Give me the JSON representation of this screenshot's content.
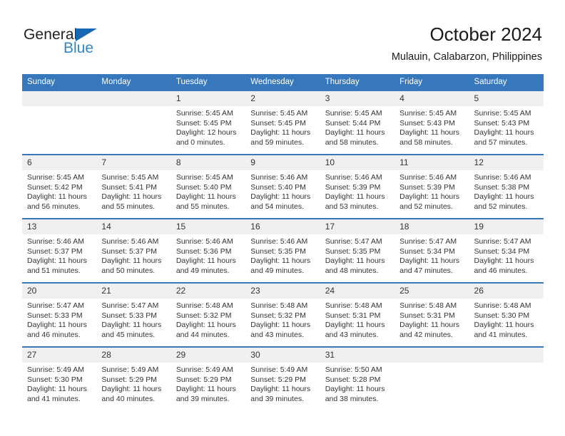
{
  "brand": {
    "name_part1": "General",
    "name_part2": "Blue",
    "accent_color": "#1668b3",
    "blue_text_color": "#2e86c8",
    "flag_icon": "flag-triangle-icon"
  },
  "header": {
    "title": "October 2024",
    "subtitle": "Mulauin, Calabarzon, Philippines"
  },
  "theme": {
    "header_blue": "#3777BC",
    "date_strip_gray": "#F0F0F0",
    "text_color": "#333333"
  },
  "calendar": {
    "weekday_headers": [
      "Sunday",
      "Monday",
      "Tuesday",
      "Wednesday",
      "Thursday",
      "Friday",
      "Saturday"
    ],
    "weeks": [
      [
        {
          "date": "",
          "sunrise": "",
          "sunset": "",
          "daylight": "",
          "empty": true
        },
        {
          "date": "",
          "sunrise": "",
          "sunset": "",
          "daylight": "",
          "empty": true
        },
        {
          "date": "1",
          "sunrise": "Sunrise: 5:45 AM",
          "sunset": "Sunset: 5:45 PM",
          "daylight": "Daylight: 12 hours and 0 minutes."
        },
        {
          "date": "2",
          "sunrise": "Sunrise: 5:45 AM",
          "sunset": "Sunset: 5:45 PM",
          "daylight": "Daylight: 11 hours and 59 minutes."
        },
        {
          "date": "3",
          "sunrise": "Sunrise: 5:45 AM",
          "sunset": "Sunset: 5:44 PM",
          "daylight": "Daylight: 11 hours and 58 minutes."
        },
        {
          "date": "4",
          "sunrise": "Sunrise: 5:45 AM",
          "sunset": "Sunset: 5:43 PM",
          "daylight": "Daylight: 11 hours and 58 minutes."
        },
        {
          "date": "5",
          "sunrise": "Sunrise: 5:45 AM",
          "sunset": "Sunset: 5:43 PM",
          "daylight": "Daylight: 11 hours and 57 minutes."
        }
      ],
      [
        {
          "date": "6",
          "sunrise": "Sunrise: 5:45 AM",
          "sunset": "Sunset: 5:42 PM",
          "daylight": "Daylight: 11 hours and 56 minutes."
        },
        {
          "date": "7",
          "sunrise": "Sunrise: 5:45 AM",
          "sunset": "Sunset: 5:41 PM",
          "daylight": "Daylight: 11 hours and 55 minutes."
        },
        {
          "date": "8",
          "sunrise": "Sunrise: 5:45 AM",
          "sunset": "Sunset: 5:40 PM",
          "daylight": "Daylight: 11 hours and 55 minutes."
        },
        {
          "date": "9",
          "sunrise": "Sunrise: 5:46 AM",
          "sunset": "Sunset: 5:40 PM",
          "daylight": "Daylight: 11 hours and 54 minutes."
        },
        {
          "date": "10",
          "sunrise": "Sunrise: 5:46 AM",
          "sunset": "Sunset: 5:39 PM",
          "daylight": "Daylight: 11 hours and 53 minutes."
        },
        {
          "date": "11",
          "sunrise": "Sunrise: 5:46 AM",
          "sunset": "Sunset: 5:39 PM",
          "daylight": "Daylight: 11 hours and 52 minutes."
        },
        {
          "date": "12",
          "sunrise": "Sunrise: 5:46 AM",
          "sunset": "Sunset: 5:38 PM",
          "daylight": "Daylight: 11 hours and 52 minutes."
        }
      ],
      [
        {
          "date": "13",
          "sunrise": "Sunrise: 5:46 AM",
          "sunset": "Sunset: 5:37 PM",
          "daylight": "Daylight: 11 hours and 51 minutes."
        },
        {
          "date": "14",
          "sunrise": "Sunrise: 5:46 AM",
          "sunset": "Sunset: 5:37 PM",
          "daylight": "Daylight: 11 hours and 50 minutes."
        },
        {
          "date": "15",
          "sunrise": "Sunrise: 5:46 AM",
          "sunset": "Sunset: 5:36 PM",
          "daylight": "Daylight: 11 hours and 49 minutes."
        },
        {
          "date": "16",
          "sunrise": "Sunrise: 5:46 AM",
          "sunset": "Sunset: 5:35 PM",
          "daylight": "Daylight: 11 hours and 49 minutes."
        },
        {
          "date": "17",
          "sunrise": "Sunrise: 5:47 AM",
          "sunset": "Sunset: 5:35 PM",
          "daylight": "Daylight: 11 hours and 48 minutes."
        },
        {
          "date": "18",
          "sunrise": "Sunrise: 5:47 AM",
          "sunset": "Sunset: 5:34 PM",
          "daylight": "Daylight: 11 hours and 47 minutes."
        },
        {
          "date": "19",
          "sunrise": "Sunrise: 5:47 AM",
          "sunset": "Sunset: 5:34 PM",
          "daylight": "Daylight: 11 hours and 46 minutes."
        }
      ],
      [
        {
          "date": "20",
          "sunrise": "Sunrise: 5:47 AM",
          "sunset": "Sunset: 5:33 PM",
          "daylight": "Daylight: 11 hours and 46 minutes."
        },
        {
          "date": "21",
          "sunrise": "Sunrise: 5:47 AM",
          "sunset": "Sunset: 5:33 PM",
          "daylight": "Daylight: 11 hours and 45 minutes."
        },
        {
          "date": "22",
          "sunrise": "Sunrise: 5:48 AM",
          "sunset": "Sunset: 5:32 PM",
          "daylight": "Daylight: 11 hours and 44 minutes."
        },
        {
          "date": "23",
          "sunrise": "Sunrise: 5:48 AM",
          "sunset": "Sunset: 5:32 PM",
          "daylight": "Daylight: 11 hours and 43 minutes."
        },
        {
          "date": "24",
          "sunrise": "Sunrise: 5:48 AM",
          "sunset": "Sunset: 5:31 PM",
          "daylight": "Daylight: 11 hours and 43 minutes."
        },
        {
          "date": "25",
          "sunrise": "Sunrise: 5:48 AM",
          "sunset": "Sunset: 5:31 PM",
          "daylight": "Daylight: 11 hours and 42 minutes."
        },
        {
          "date": "26",
          "sunrise": "Sunrise: 5:48 AM",
          "sunset": "Sunset: 5:30 PM",
          "daylight": "Daylight: 11 hours and 41 minutes."
        }
      ],
      [
        {
          "date": "27",
          "sunrise": "Sunrise: 5:49 AM",
          "sunset": "Sunset: 5:30 PM",
          "daylight": "Daylight: 11 hours and 41 minutes."
        },
        {
          "date": "28",
          "sunrise": "Sunrise: 5:49 AM",
          "sunset": "Sunset: 5:29 PM",
          "daylight": "Daylight: 11 hours and 40 minutes."
        },
        {
          "date": "29",
          "sunrise": "Sunrise: 5:49 AM",
          "sunset": "Sunset: 5:29 PM",
          "daylight": "Daylight: 11 hours and 39 minutes."
        },
        {
          "date": "30",
          "sunrise": "Sunrise: 5:49 AM",
          "sunset": "Sunset: 5:29 PM",
          "daylight": "Daylight: 11 hours and 39 minutes."
        },
        {
          "date": "31",
          "sunrise": "Sunrise: 5:50 AM",
          "sunset": "Sunset: 5:28 PM",
          "daylight": "Daylight: 11 hours and 38 minutes."
        },
        {
          "date": "",
          "sunrise": "",
          "sunset": "",
          "daylight": "",
          "empty": true
        },
        {
          "date": "",
          "sunrise": "",
          "sunset": "",
          "daylight": "",
          "empty": true
        }
      ]
    ]
  }
}
